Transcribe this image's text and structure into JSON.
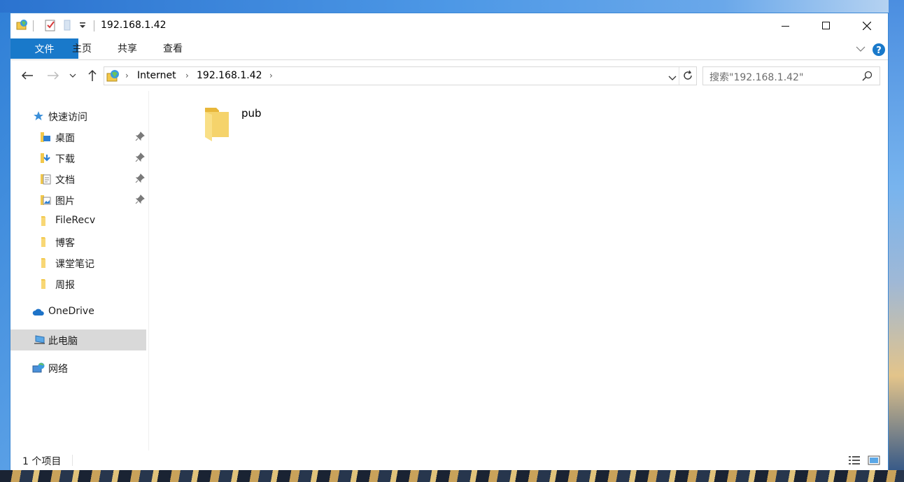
{
  "window": {
    "title": "192.168.1.42",
    "controls": [
      "minimize-icon",
      "maximize-icon",
      "close-icon"
    ]
  },
  "ribbon": {
    "tabs": [
      {
        "label": "文件",
        "active": true
      },
      {
        "label": "主页"
      },
      {
        "label": "共享"
      },
      {
        "label": "查看"
      }
    ],
    "accent": "#1979ca"
  },
  "address": {
    "crumbs": [
      "Internet",
      "192.168.1.42"
    ],
    "search_placeholder": "搜索\"192.168.1.42\""
  },
  "sidebar": {
    "quick_access": "快速访问",
    "items": [
      {
        "label": "桌面",
        "pinned": true
      },
      {
        "label": "下载",
        "pinned": true
      },
      {
        "label": "文档",
        "pinned": true
      },
      {
        "label": "图片",
        "pinned": true
      },
      {
        "label": "FileRecv"
      },
      {
        "label": "博客"
      },
      {
        "label": "课堂笔记"
      },
      {
        "label": "周报"
      }
    ],
    "onedrive": "OneDrive",
    "this_pc": "此电脑",
    "network": "网络"
  },
  "content": {
    "items": [
      {
        "name": "pub",
        "type": "folder"
      }
    ]
  },
  "status": {
    "count_text": "1 个项目"
  }
}
